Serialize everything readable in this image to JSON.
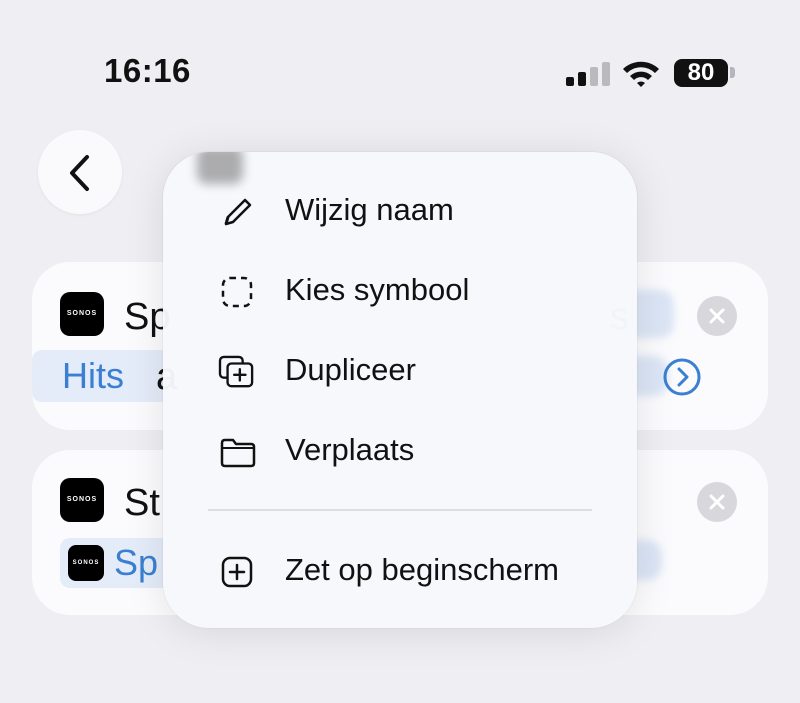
{
  "status_bar": {
    "time": "16:16",
    "battery": "80"
  },
  "card1": {
    "title": "Sp",
    "chip_label": "Hits",
    "second_text": "a",
    "trailing_text": "s",
    "app_icon_text": "SONOS"
  },
  "card2": {
    "title": "St",
    "chip_label": "Sp",
    "app_icon_text": "SONOS"
  },
  "menu": {
    "items": [
      {
        "label": "Wijzig naam",
        "icon": "pencil-icon"
      },
      {
        "label": "Kies symbool",
        "icon": "dashed-square-icon"
      },
      {
        "label": "Dupliceer",
        "icon": "duplicate-icon"
      },
      {
        "label": "Verplaats",
        "icon": "folder-icon"
      },
      {
        "label": "Zet op beginscherm",
        "icon": "add-square-icon"
      }
    ]
  },
  "colors": {
    "accent": "#3a7fd1",
    "background": "#eeeef3",
    "card": "#fbfbfd"
  }
}
